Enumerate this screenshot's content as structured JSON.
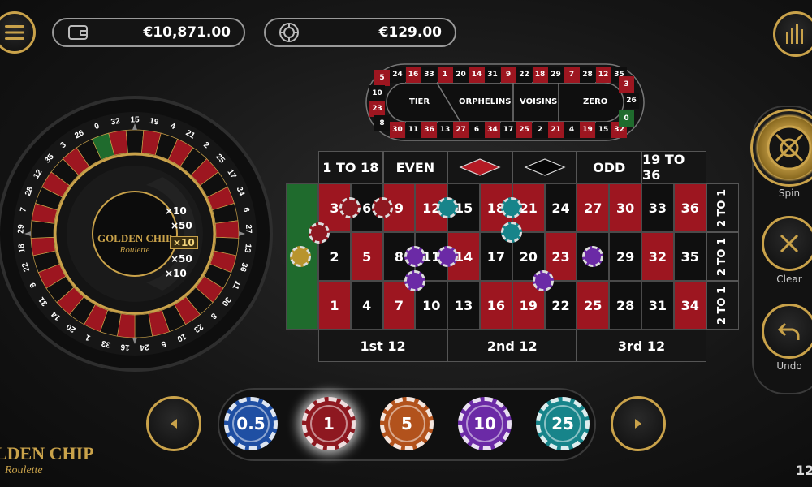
{
  "header": {
    "balance": "€10,871.00",
    "total_bet": "€129.00",
    "wallet_icon": "wallet-icon",
    "chip_icon": "chip-icon",
    "menu_icon": "hamburger-menu-icon",
    "stats_icon": "statistics-bars-icon"
  },
  "wheel": {
    "logo_line1": "GOLDEN CHIP",
    "logo_line2": "Roulette",
    "numbers_order": [
      "0",
      "32",
      "15",
      "19",
      "4",
      "21",
      "2",
      "25",
      "17",
      "34",
      "6",
      "27",
      "13",
      "36",
      "11",
      "30",
      "8",
      "23",
      "10",
      "5",
      "24",
      "16",
      "33",
      "1",
      "20",
      "14",
      "31",
      "9",
      "22",
      "18",
      "29",
      "7",
      "28",
      "12",
      "35",
      "3",
      "26"
    ],
    "multipliers": [
      "×10",
      "×50",
      "×10",
      "×50",
      "×10"
    ]
  },
  "racetrack": {
    "top": [
      "24",
      "16",
      "33",
      "1",
      "20",
      "14",
      "31",
      "9",
      "22",
      "18",
      "29",
      "7",
      "28",
      "12",
      "35"
    ],
    "bottom": [
      "30",
      "11",
      "36",
      "13",
      "27",
      "6",
      "34",
      "17",
      "25",
      "2",
      "21",
      "4",
      "19",
      "15",
      "32"
    ],
    "left": [
      "5",
      "10",
      "23",
      "8"
    ],
    "right": [
      "3",
      "26",
      "0"
    ],
    "sections": [
      "TIER",
      "ORPHELINS",
      "VOISINS",
      "ZERO"
    ]
  },
  "table": {
    "top_outside": [
      "1 TO 18",
      "EVEN",
      "",
      "",
      "ODD",
      "19 TO 36"
    ],
    "rows": [
      [
        "3",
        "6",
        "9",
        "12",
        "15",
        "18",
        "21",
        "24",
        "27",
        "30",
        "33",
        "36"
      ],
      [
        "2",
        "5",
        "8",
        "11",
        "14",
        "17",
        "20",
        "23",
        "26",
        "29",
        "32",
        "35"
      ],
      [
        "1",
        "4",
        "7",
        "10",
        "13",
        "16",
        "19",
        "22",
        "25",
        "28",
        "31",
        "34"
      ]
    ],
    "row_colors": [
      [
        "r",
        "b",
        "r",
        "r",
        "b",
        "r",
        "r",
        "b",
        "r",
        "r",
        "b",
        "r"
      ],
      [
        "b",
        "r",
        "b",
        "b",
        "r",
        "b",
        "b",
        "r",
        "b",
        "b",
        "r",
        "b"
      ],
      [
        "r",
        "b",
        "r",
        "b",
        "b",
        "r",
        "r",
        "b",
        "r",
        "b",
        "b",
        "r"
      ]
    ],
    "columns": [
      "2 TO 1",
      "2 TO 1",
      "2 TO 1"
    ],
    "dozens": [
      "1st 12",
      "2nd 12",
      "3rd 12"
    ]
  },
  "controls": {
    "spin_label": "Spin",
    "clear_label": "Clear",
    "undo_label": "Undo"
  },
  "chips": [
    {
      "value": "0.5",
      "color": "#1f4fa3"
    },
    {
      "value": "1",
      "color": "#8e1820"
    },
    {
      "value": "5",
      "color": "#b2521c"
    },
    {
      "value": "10",
      "color": "#6b2aa6"
    },
    {
      "value": "25",
      "color": "#17848a"
    }
  ],
  "footer": {
    "logo_line1": "LDEN CHIP",
    "logo_line2": "Roulette",
    "time_fragment": "12"
  },
  "colors": {
    "gold": "#c9a24a",
    "red": "#9d1620",
    "green": "#1f6b2d"
  }
}
